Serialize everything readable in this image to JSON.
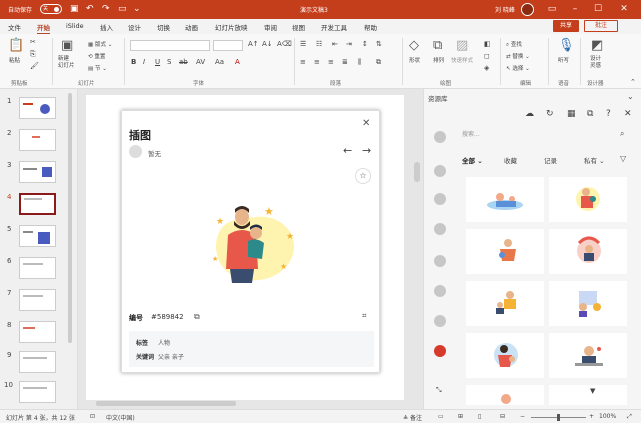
{
  "titlebar": {
    "autosave_label": "自动保存",
    "autosave_state": "关",
    "doc_title": "演示文稿3",
    "user_name": "刘 晓峰",
    "minimize": "–",
    "maximize": "☐",
    "close": "✕"
  },
  "menu": {
    "items": [
      "文件",
      "开始",
      "iSlide",
      "插入",
      "设计",
      "切换",
      "动画",
      "幻灯片放映",
      "审阅",
      "视图",
      "开发工具",
      "帮助"
    ],
    "active": "开始",
    "share": "共享",
    "comment": "批注"
  },
  "ribbon": {
    "paste": "粘贴",
    "clipboard": "剪贴板",
    "new_slide": "新建\n幻灯片",
    "layout": "版式",
    "reset": "重置",
    "section": "节",
    "slides_group": "幻灯片",
    "font_group": "字体",
    "paragraph_group": "段落",
    "shape": "形状",
    "arrange": "排列",
    "quick_style": "快速样式",
    "drawing_group": "绘图",
    "find": "查找",
    "replace": "替换",
    "select": "选择",
    "editing_group": "编辑",
    "dictate": "听写",
    "voice_group": "语音",
    "designer": "设计\n灵感",
    "designer_group": "设计器",
    "format_buttons": [
      "B",
      "I",
      "U",
      "S",
      "ab",
      "AV",
      "Aa",
      "A"
    ]
  },
  "thumbnails": {
    "numbers": [
      "1",
      "2",
      "3",
      "4",
      "5",
      "6",
      "7",
      "8",
      "9",
      "10"
    ],
    "active_index": 3
  },
  "dialog": {
    "title": "插图",
    "close": "✕",
    "author": "暂无",
    "prev": "←",
    "next": "→",
    "star": "☆",
    "code_label": "编号",
    "code_value": "#589842",
    "tags_label": "标签",
    "tags_value": "人物",
    "keywords_label": "关键词",
    "keywords_value": "父亲 亲子"
  },
  "resource_panel": {
    "title": "资源库",
    "close": "✕",
    "search_placeholder": "搜索...",
    "tabs": [
      "全部",
      "收藏",
      "记录",
      "私有"
    ],
    "tool_icons": [
      "☁",
      "↻",
      "▦",
      "⧉",
      "?",
      "✕"
    ]
  },
  "status": {
    "slide_info": "幻灯片 第 4 张，共 12 张",
    "language": "中文(中国)",
    "notes": "备注",
    "zoom": "100%"
  }
}
